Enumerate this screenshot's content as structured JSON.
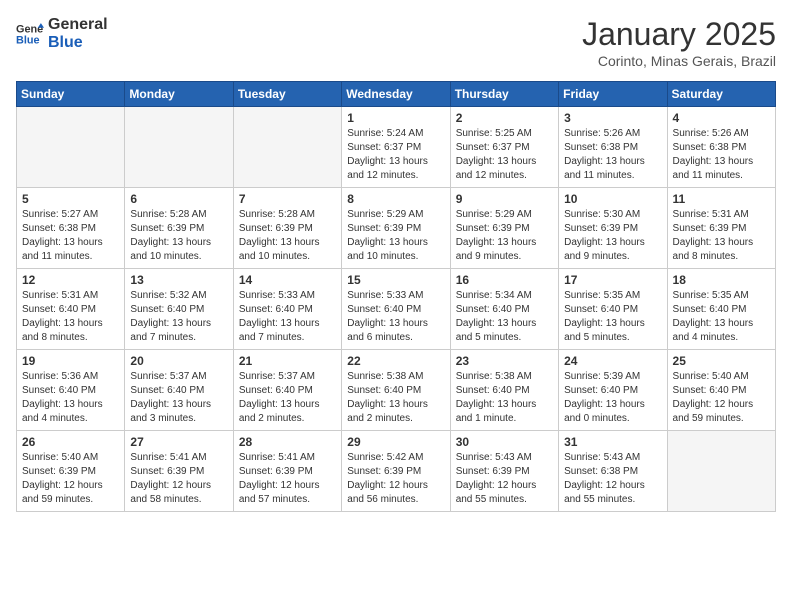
{
  "logo": {
    "text_general": "General",
    "text_blue": "Blue"
  },
  "calendar": {
    "title": "January 2025",
    "subtitle": "Corinto, Minas Gerais, Brazil"
  },
  "weekdays": [
    "Sunday",
    "Monday",
    "Tuesday",
    "Wednesday",
    "Thursday",
    "Friday",
    "Saturday"
  ],
  "weeks": [
    [
      {
        "num": "",
        "empty": true
      },
      {
        "num": "",
        "empty": true
      },
      {
        "num": "",
        "empty": true
      },
      {
        "num": "1",
        "sunrise": "5:24 AM",
        "sunset": "6:37 PM",
        "daylight": "13 hours and 12 minutes."
      },
      {
        "num": "2",
        "sunrise": "5:25 AM",
        "sunset": "6:37 PM",
        "daylight": "13 hours and 12 minutes."
      },
      {
        "num": "3",
        "sunrise": "5:26 AM",
        "sunset": "6:38 PM",
        "daylight": "13 hours and 11 minutes."
      },
      {
        "num": "4",
        "sunrise": "5:26 AM",
        "sunset": "6:38 PM",
        "daylight": "13 hours and 11 minutes."
      }
    ],
    [
      {
        "num": "5",
        "sunrise": "5:27 AM",
        "sunset": "6:38 PM",
        "daylight": "13 hours and 11 minutes."
      },
      {
        "num": "6",
        "sunrise": "5:28 AM",
        "sunset": "6:39 PM",
        "daylight": "13 hours and 10 minutes."
      },
      {
        "num": "7",
        "sunrise": "5:28 AM",
        "sunset": "6:39 PM",
        "daylight": "13 hours and 10 minutes."
      },
      {
        "num": "8",
        "sunrise": "5:29 AM",
        "sunset": "6:39 PM",
        "daylight": "13 hours and 10 minutes."
      },
      {
        "num": "9",
        "sunrise": "5:29 AM",
        "sunset": "6:39 PM",
        "daylight": "13 hours and 9 minutes."
      },
      {
        "num": "10",
        "sunrise": "5:30 AM",
        "sunset": "6:39 PM",
        "daylight": "13 hours and 9 minutes."
      },
      {
        "num": "11",
        "sunrise": "5:31 AM",
        "sunset": "6:39 PM",
        "daylight": "13 hours and 8 minutes."
      }
    ],
    [
      {
        "num": "12",
        "sunrise": "5:31 AM",
        "sunset": "6:40 PM",
        "daylight": "13 hours and 8 minutes."
      },
      {
        "num": "13",
        "sunrise": "5:32 AM",
        "sunset": "6:40 PM",
        "daylight": "13 hours and 7 minutes."
      },
      {
        "num": "14",
        "sunrise": "5:33 AM",
        "sunset": "6:40 PM",
        "daylight": "13 hours and 7 minutes."
      },
      {
        "num": "15",
        "sunrise": "5:33 AM",
        "sunset": "6:40 PM",
        "daylight": "13 hours and 6 minutes."
      },
      {
        "num": "16",
        "sunrise": "5:34 AM",
        "sunset": "6:40 PM",
        "daylight": "13 hours and 5 minutes."
      },
      {
        "num": "17",
        "sunrise": "5:35 AM",
        "sunset": "6:40 PM",
        "daylight": "13 hours and 5 minutes."
      },
      {
        "num": "18",
        "sunrise": "5:35 AM",
        "sunset": "6:40 PM",
        "daylight": "13 hours and 4 minutes."
      }
    ],
    [
      {
        "num": "19",
        "sunrise": "5:36 AM",
        "sunset": "6:40 PM",
        "daylight": "13 hours and 4 minutes."
      },
      {
        "num": "20",
        "sunrise": "5:37 AM",
        "sunset": "6:40 PM",
        "daylight": "13 hours and 3 minutes."
      },
      {
        "num": "21",
        "sunrise": "5:37 AM",
        "sunset": "6:40 PM",
        "daylight": "13 hours and 2 minutes."
      },
      {
        "num": "22",
        "sunrise": "5:38 AM",
        "sunset": "6:40 PM",
        "daylight": "13 hours and 2 minutes."
      },
      {
        "num": "23",
        "sunrise": "5:38 AM",
        "sunset": "6:40 PM",
        "daylight": "13 hours and 1 minute."
      },
      {
        "num": "24",
        "sunrise": "5:39 AM",
        "sunset": "6:40 PM",
        "daylight": "13 hours and 0 minutes."
      },
      {
        "num": "25",
        "sunrise": "5:40 AM",
        "sunset": "6:40 PM",
        "daylight": "12 hours and 59 minutes."
      }
    ],
    [
      {
        "num": "26",
        "sunrise": "5:40 AM",
        "sunset": "6:39 PM",
        "daylight": "12 hours and 59 minutes."
      },
      {
        "num": "27",
        "sunrise": "5:41 AM",
        "sunset": "6:39 PM",
        "daylight": "12 hours and 58 minutes."
      },
      {
        "num": "28",
        "sunrise": "5:41 AM",
        "sunset": "6:39 PM",
        "daylight": "12 hours and 57 minutes."
      },
      {
        "num": "29",
        "sunrise": "5:42 AM",
        "sunset": "6:39 PM",
        "daylight": "12 hours and 56 minutes."
      },
      {
        "num": "30",
        "sunrise": "5:43 AM",
        "sunset": "6:39 PM",
        "daylight": "12 hours and 55 minutes."
      },
      {
        "num": "31",
        "sunrise": "5:43 AM",
        "sunset": "6:38 PM",
        "daylight": "12 hours and 55 minutes."
      },
      {
        "num": "",
        "empty": true
      }
    ]
  ]
}
